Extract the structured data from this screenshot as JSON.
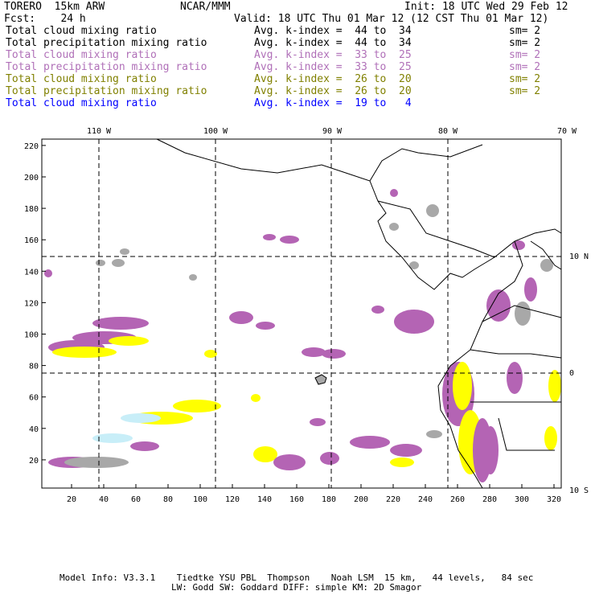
{
  "header": {
    "model": "TORERO  15km ARW",
    "org": "NCAR/MMM",
    "init": "Init: 18 UTC Wed 29 Feb 12",
    "fcst": "Fcst:    24 h",
    "valid": "Valid: 18 UTC Thu 01 Mar 12 (12 CST Thu 01 Mar 12)"
  },
  "legend": [
    {
      "field": "Total cloud mixing ratio",
      "range": "Avg. k-index =  44 to  34",
      "sm": "sm= 2",
      "color": "#000000"
    },
    {
      "field": "Total precipitation mixing ratio",
      "range": "Avg. k-index =  44 to  34",
      "sm": "sm= 2",
      "color": "#000000"
    },
    {
      "field": "Total cloud mixing ratio",
      "range": "Avg. k-index =  33 to  25",
      "sm": "sm= 2",
      "color": "#b070b8"
    },
    {
      "field": "Total precipitation mixing ratio",
      "range": "Avg. k-index =  33 to  25",
      "sm": "sm= 2",
      "color": "#b070b8"
    },
    {
      "field": "Total cloud mixing ratio",
      "range": "Avg. k-index =  26 to  20",
      "sm": "sm= 2",
      "color": "#808000"
    },
    {
      "field": "Total precipitation mixing ratio",
      "range": "Avg. k-index =  26 to  20",
      "sm": "sm= 2",
      "color": "#808000"
    },
    {
      "field": "Total cloud mixing ratio",
      "range": "Avg. k-index =  19 to   4",
      "sm": "",
      "color": "#0000ff"
    }
  ],
  "map": {
    "lon_labels": [
      "110 W",
      "100 W",
      "90 W",
      "80 W",
      "70 W"
    ],
    "lat_labels": [
      "10 N",
      "0",
      "10 S"
    ],
    "x_ticks": [
      "20",
      "40",
      "60",
      "80",
      "100",
      "120",
      "140",
      "160",
      "180",
      "200",
      "220",
      "240",
      "260",
      "280",
      "300",
      "320"
    ],
    "y_ticks": [
      "20",
      "40",
      "60",
      "80",
      "100",
      "120",
      "140",
      "160",
      "180",
      "200",
      "220"
    ],
    "colors": {
      "gray": "#a8a8a8",
      "purple": "#b464b4",
      "yellow": "#ffff00",
      "cyan": "#c8eef8"
    }
  },
  "footer": {
    "line1": "Model Info: V3.3.1    Tiedtke YSU PBL  Thompson    Noah LSM  15 km,   44 levels,   84 sec",
    "line2": "LW: Godd SW: Goddard DIFF: simple KM: 2D Smagor"
  }
}
